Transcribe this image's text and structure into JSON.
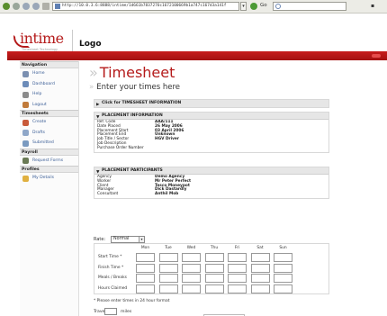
{
  "browser": {
    "url": "http://10.0.3.6:8888/intime/1d661b7837276c1672100669b1a747c167d3a141f",
    "go_label": "Go",
    "search_value": ""
  },
  "header": {
    "brand": "intime",
    "brand_sub": "Timesheet Technology",
    "logo_label": "Logo"
  },
  "sidebar": {
    "sections": [
      {
        "title": "Navigation",
        "items": [
          {
            "label": "Home",
            "icon": "home-icon",
            "color": "#7a8fb0"
          },
          {
            "label": "Dashboard",
            "icon": "dashboard-icon",
            "color": "#6b8bb8"
          },
          {
            "label": "Help",
            "icon": "help-icon",
            "color": "#8a8a8a"
          },
          {
            "label": "Logout",
            "icon": "logout-icon",
            "color": "#c07a3a"
          }
        ]
      },
      {
        "title": "Timesheets",
        "items": [
          {
            "label": "Create",
            "icon": "create-icon",
            "color": "#c85a3a"
          },
          {
            "label": "Drafts",
            "icon": "drafts-icon",
            "color": "#8fa7c8"
          },
          {
            "label": "Submitted",
            "icon": "submitted-icon",
            "color": "#7a9ac0"
          }
        ]
      },
      {
        "title": "Payroll",
        "items": [
          {
            "label": "Request Forms",
            "icon": "request-forms-icon",
            "color": "#6a7a55"
          }
        ]
      },
      {
        "title": "Profiles",
        "items": [
          {
            "label": "My Details",
            "icon": "my-details-icon",
            "color": "#e0b040"
          }
        ]
      }
    ]
  },
  "main": {
    "title": "Timesheet",
    "subtitle": "Enter your times here",
    "info_toggle": "Click for TIMESHEET INFORMATION",
    "placement_info": {
      "heading": "PLACEMENT INFORMATION",
      "rows": [
        {
          "k": "Ref. Code",
          "v": "AAA/111"
        },
        {
          "k": "Date Placed",
          "v": "26 May 2006"
        },
        {
          "k": "Placement Start",
          "v": "03 April 2006"
        },
        {
          "k": "Placement End",
          "v": "Unknown"
        },
        {
          "k": "Job Title / Sector",
          "v": "HGV Driver"
        },
        {
          "k": "Job Description",
          "v": ""
        },
        {
          "k": "Purchase Order Number",
          "v": ""
        }
      ]
    },
    "participants": {
      "heading": "PLACEMENT PARTICIPANTS",
      "rows": [
        {
          "k": "Agency",
          "v": "Demo Agency"
        },
        {
          "k": "Worker",
          "v": "Mr Peter Perfect"
        },
        {
          "k": "Client",
          "v": "Tesco Moneypot"
        },
        {
          "k": "Manager",
          "v": "Dick Dastardly"
        },
        {
          "k": "Consultant",
          "v": "Anthil Mob"
        }
      ]
    },
    "rate_label": "Rate:",
    "rate_value": "Normal",
    "days": [
      "Mon",
      "Tue",
      "Wed",
      "Thu",
      "Fri",
      "Sat",
      "Sun"
    ],
    "row_labels": [
      "Start Time *",
      "Finish Time *",
      "Meals / Breaks",
      "Hours Claimed"
    ],
    "note": "* Please enter times in 24 hour format",
    "travel_label": "Travel:",
    "travel_unit": "miles"
  }
}
